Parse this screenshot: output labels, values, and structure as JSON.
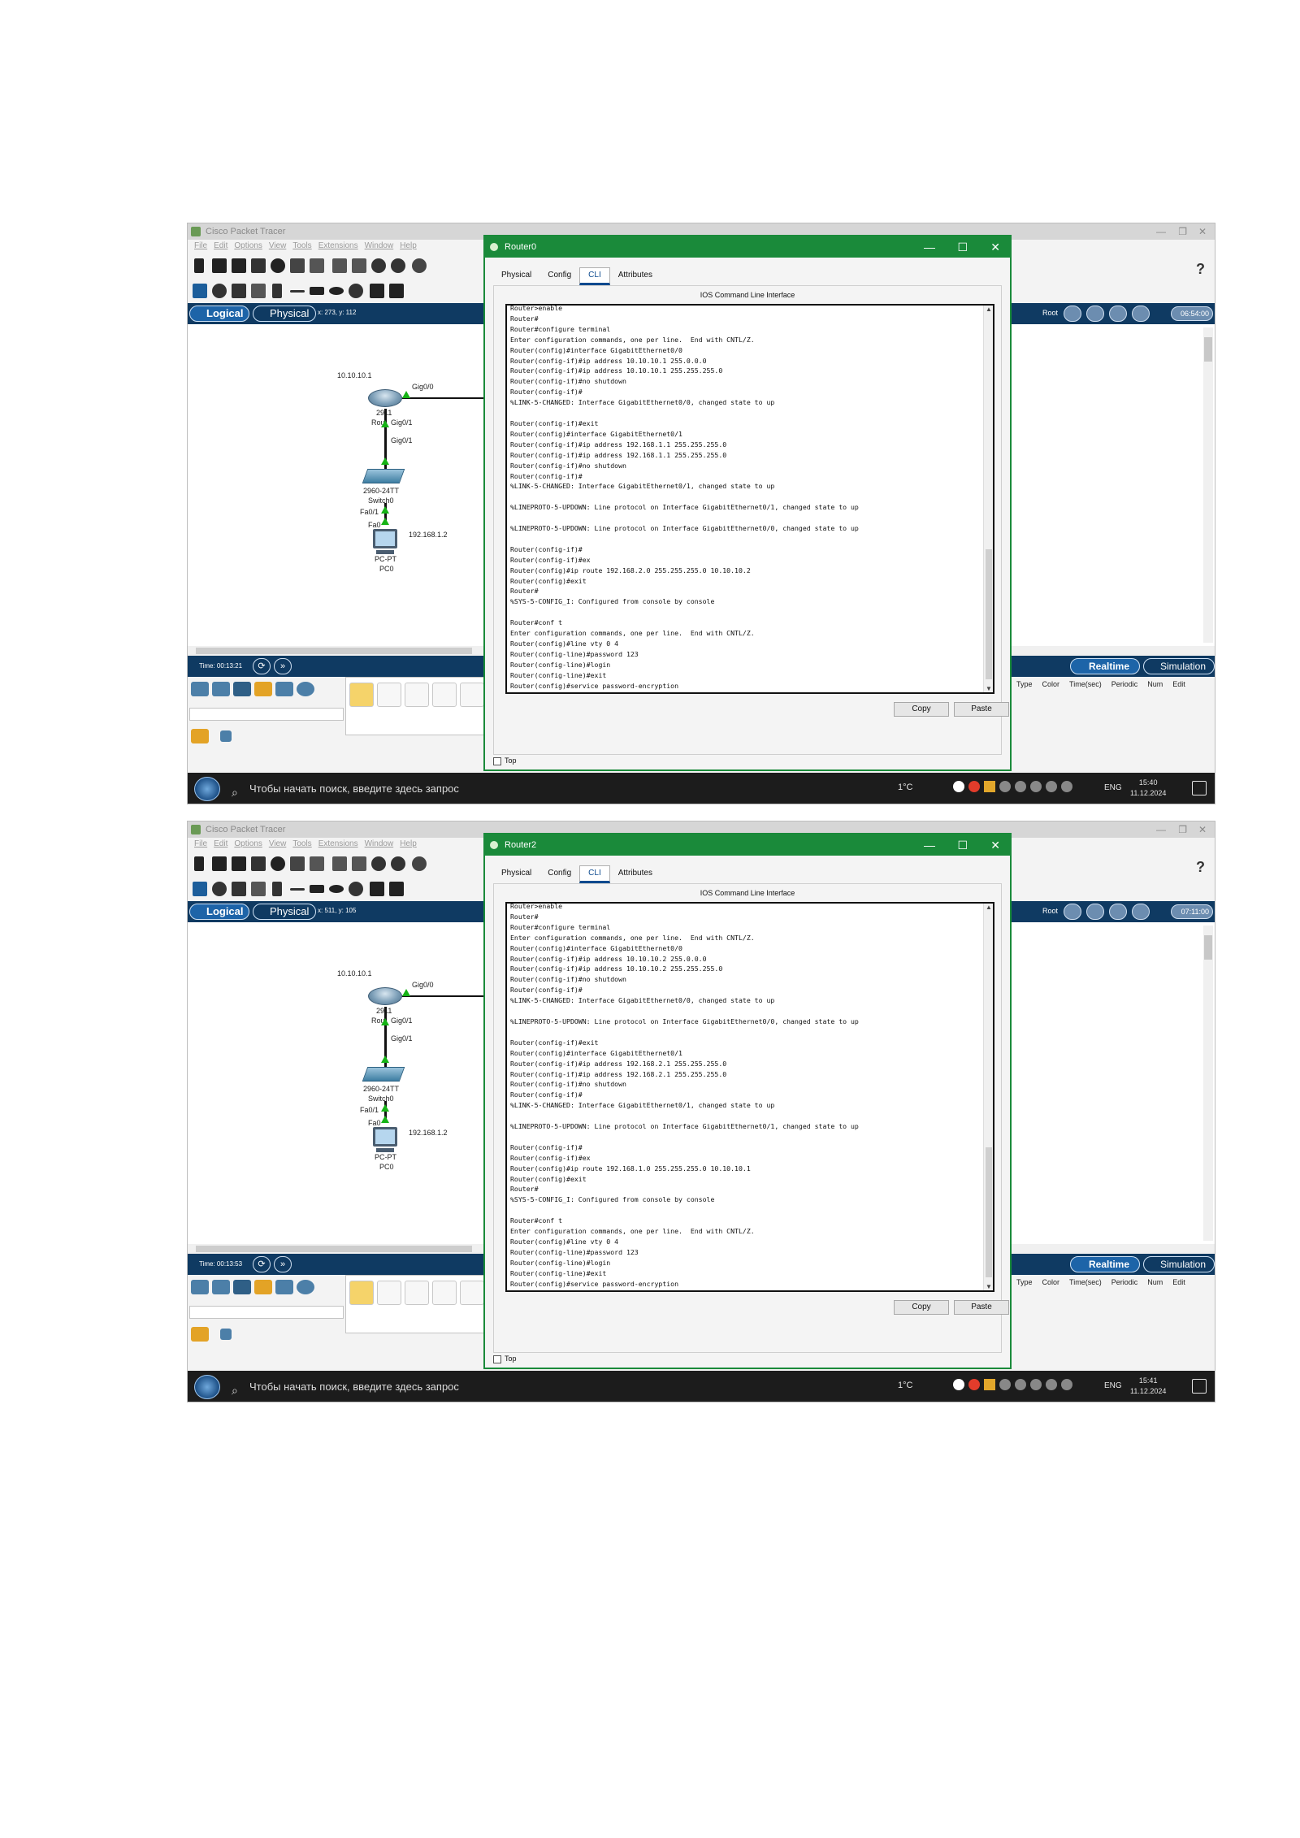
{
  "app": {
    "window_title": "Cisco Packet Tracer",
    "menu": [
      "File",
      "Edit",
      "Options",
      "View",
      "Tools",
      "Extensions",
      "Window",
      "Help"
    ],
    "help": "?",
    "logical_label": "Logical",
    "physical_label": "Physical",
    "root_label": "Root",
    "realtime_label": "Realtime",
    "simulation_label": "Simulation",
    "event_columns": [
      "Type",
      "Color",
      "Time(sec)",
      "Periodic",
      "Num",
      "Edit"
    ],
    "taskbar_search": "Чтобы начать поиск, введите здесь запрос",
    "weather": "1°C",
    "lang": "ENG",
    "date": "11.12.2024"
  },
  "topology": {
    "router_ip": "10.10.10.1",
    "router_port_right": "Gig0/0",
    "router_model": "2911",
    "router_name": "Rou",
    "router_port_down": "Gig0/1",
    "switch_port_up": "Gig0/1",
    "switch_model": "2960-24TT",
    "switch_name": "Switch0",
    "switch_port_down": "Fa0/1",
    "pc_port": "Fa0",
    "pc_ip": "192.168.1.2",
    "pc_model": "PC-PT",
    "pc_name": "PC0"
  },
  "dialog": {
    "tabs": [
      "Physical",
      "Config",
      "CLI",
      "Attributes"
    ],
    "ios_header": "IOS Command Line Interface",
    "copy_label": "Copy",
    "paste_label": "Paste",
    "top_label": "Top",
    "min_icon": "—",
    "max_icon": "☐",
    "close_icon": "✕"
  },
  "screenshots": [
    {
      "coords": "x: 273, y: 112",
      "clock": "06:54:00",
      "time": "Time: 00:13:21",
      "tray_time": "15:40",
      "dialog_title": "Router0",
      "cli": "Router>enable\nRouter#\nRouter#configure terminal\nEnter configuration commands, one per line.  End with CNTL/Z.\nRouter(config)#interface GigabitEthernet0/0\nRouter(config-if)#ip address 10.10.10.1 255.0.0.0\nRouter(config-if)#ip address 10.10.10.1 255.255.255.0\nRouter(config-if)#no shutdown\nRouter(config-if)#\n%LINK-5-CHANGED: Interface GigabitEthernet0/0, changed state to up\n\nRouter(config-if)#exit\nRouter(config)#interface GigabitEthernet0/1\nRouter(config-if)#ip address 192.168.1.1 255.255.255.0\nRouter(config-if)#ip address 192.168.1.1 255.255.255.0\nRouter(config-if)#no shutdown\nRouter(config-if)#\n%LINK-5-CHANGED: Interface GigabitEthernet0/1, changed state to up\n\n%LINEPROTO-5-UPDOWN: Line protocol on Interface GigabitEthernet0/1, changed state to up\n\n%LINEPROTO-5-UPDOWN: Line protocol on Interface GigabitEthernet0/0, changed state to up\n\nRouter(config-if)#\nRouter(config-if)#ex\nRouter(config)#ip route 192.168.2.0 255.255.255.0 10.10.10.2\nRouter(config)#exit\nRouter#\n%SYS-5-CONFIG_I: Configured from console by console\n\nRouter#conf t\nEnter configuration commands, one per line.  End with CNTL/Z.\nRouter(config)#line vty 0 4\nRouter(config-line)#password 123\nRouter(config-line)#login\nRouter(config-line)#exit\nRouter(config)#service password-encryption"
    },
    {
      "coords": "x: 511, y: 105",
      "clock": "07:11:00",
      "time": "Time: 00:13:53",
      "tray_time": "15:41",
      "dialog_title": "Router2",
      "cli": "Router>enable\nRouter#\nRouter#configure terminal\nEnter configuration commands, one per line.  End with CNTL/Z.\nRouter(config)#interface GigabitEthernet0/0\nRouter(config-if)#ip address 10.10.10.2 255.0.0.0\nRouter(config-if)#ip address 10.10.10.2 255.255.255.0\nRouter(config-if)#no shutdown\nRouter(config-if)#\n%LINK-5-CHANGED: Interface GigabitEthernet0/0, changed state to up\n\n%LINEPROTO-5-UPDOWN: Line protocol on Interface GigabitEthernet0/0, changed state to up\n\nRouter(config-if)#exit\nRouter(config)#interface GigabitEthernet0/1\nRouter(config-if)#ip address 192.168.2.1 255.255.255.0\nRouter(config-if)#ip address 192.168.2.1 255.255.255.0\nRouter(config-if)#no shutdown\nRouter(config-if)#\n%LINK-5-CHANGED: Interface GigabitEthernet0/1, changed state to up\n\n%LINEPROTO-5-UPDOWN: Line protocol on Interface GigabitEthernet0/1, changed state to up\n\nRouter(config-if)#\nRouter(config-if)#ex\nRouter(config)#ip route 192.168.1.0 255.255.255.0 10.10.10.1\nRouter(config)#exit\nRouter#\n%SYS-5-CONFIG_I: Configured from console by console\n\nRouter#conf t\nEnter configuration commands, one per line.  End with CNTL/Z.\nRouter(config)#line vty 0 4\nRouter(config-line)#password 123\nRouter(config-line)#login\nRouter(config-line)#exit\nRouter(config)#service password-encryption"
    }
  ]
}
